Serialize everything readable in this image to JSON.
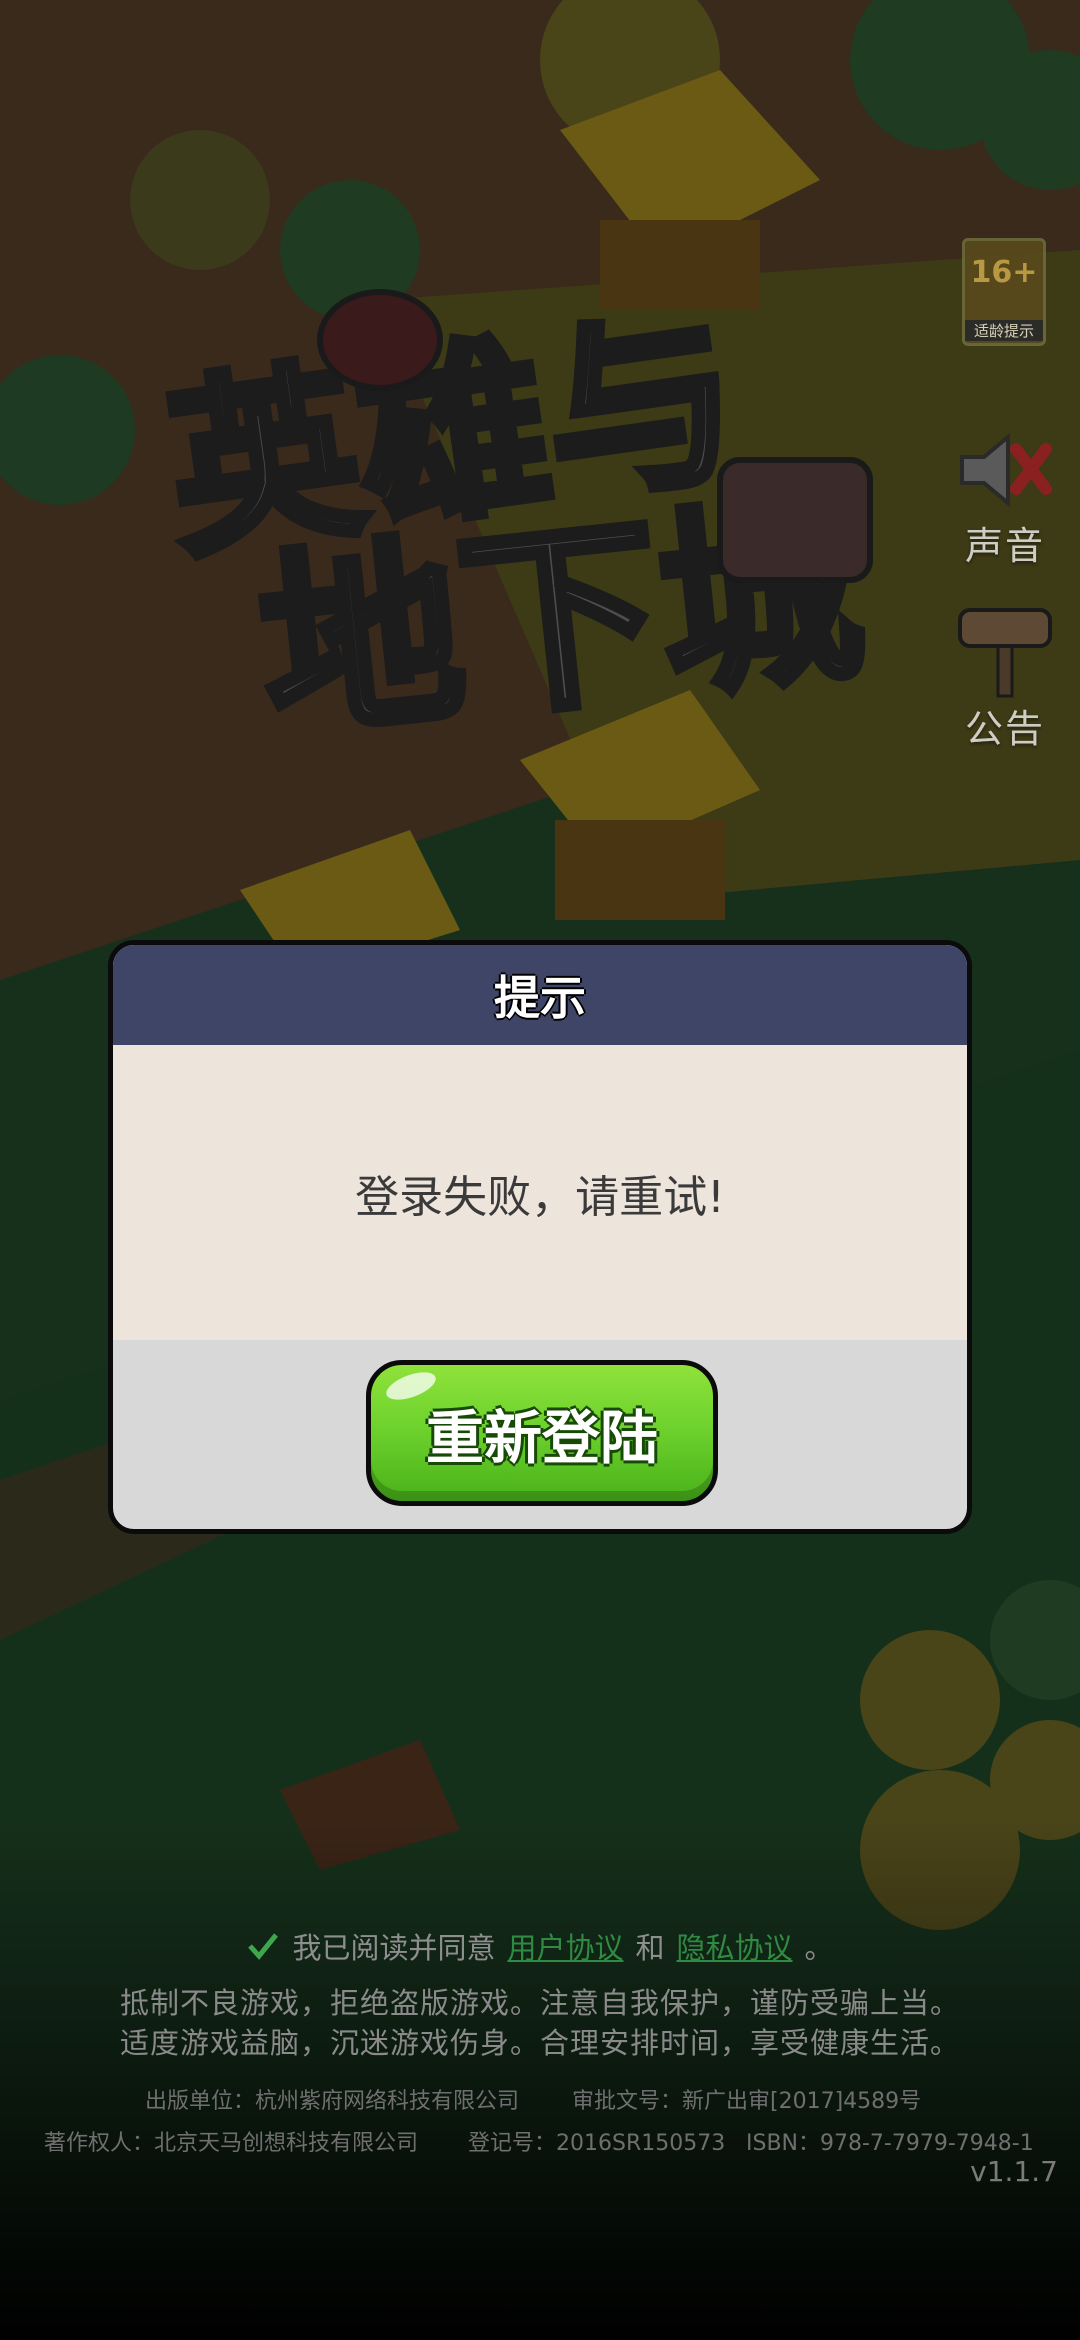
{
  "age_badge": {
    "age": "16+",
    "label": "适龄提示"
  },
  "sound": {
    "label": "声音"
  },
  "notice_board": {
    "label": "公告"
  },
  "dialog": {
    "title": "提示",
    "message": "登录失败，请重试!",
    "button_label": "重新登陆"
  },
  "agreement": {
    "prefix": "我已阅读并同意",
    "user_agreement": "用户协议",
    "and": "和",
    "privacy_agreement": "隐私协议",
    "suffix": "。",
    "checked": true
  },
  "health_notice": {
    "line1": "抵制不良游戏，拒绝盗版游戏。注意自我保护，谨防受骗上当。",
    "line2": "适度游戏益脑，沉迷游戏伤身。合理安排时间，享受健康生活。"
  },
  "legal": {
    "publisher": "出版单位：杭州紫府网络科技有限公司",
    "approval": "审批文号：新广出审[2017]4589号",
    "copyright": "著作权人：北京天马创想科技有限公司",
    "registration": "登记号：2016SR150573",
    "isbn": "ISBN：978-7-7979-7948-1"
  },
  "version": "v1.1.7",
  "colors": {
    "dialog_header": "#3e4566",
    "dialog_body": "#ede4dc",
    "button_green": "#6fd22e",
    "link_green": "#2f8a42"
  }
}
